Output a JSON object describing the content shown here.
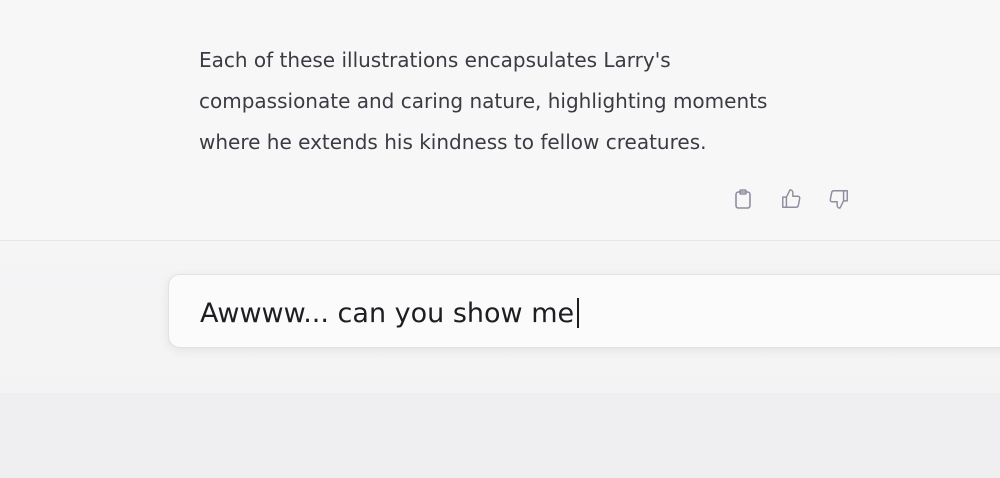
{
  "assistant_message": {
    "lines": [
      "Each of these illustrations encapsulates Larry's",
      "compassionate and caring nature, highlighting moments",
      "where he extends his kindness to fellow creatures."
    ],
    "actions": [
      {
        "icon": "clipboard-icon"
      },
      {
        "icon": "thumbs-up-icon"
      },
      {
        "icon": "thumbs-down-icon"
      }
    ]
  },
  "composer": {
    "value": "Awwww... can you show me"
  },
  "colors": {
    "text": "#3b3b44",
    "icon": "#8e8ea0",
    "background": "#f7f7f8"
  }
}
